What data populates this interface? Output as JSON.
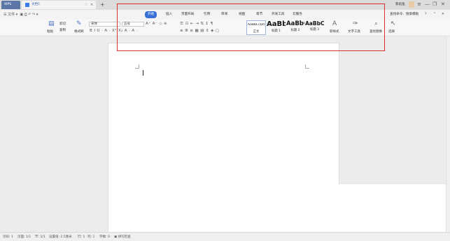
{
  "tabbar": {
    "app_tab": "WPS",
    "doc_tab": "文档1",
    "new_tab": "+",
    "user_name": "紫焰鱼",
    "window_controls": [
      "≡",
      "—",
      "❐",
      "✕"
    ]
  },
  "menubar": {
    "file_menu": "☰ 文件 ▾",
    "tabs": [
      "开始",
      "插入",
      "页面布局",
      "引用",
      "审阅",
      "视图",
      "章节",
      "开发工具",
      "云服务"
    ],
    "active_tab": "开始",
    "search": "查找命令、搜索模板",
    "right_icons": [
      "?",
      "⌃",
      "✕"
    ]
  },
  "ribbon": {
    "paste": "粘贴",
    "cut": "剪切",
    "copy": "复制",
    "format_painter": "格式刷",
    "font_name": "宋体",
    "font_size": "五号",
    "styles": [
      {
        "sample": "AaBbCcDd",
        "name": "正文"
      },
      {
        "sample": "AaBb",
        "name": "标题 1"
      },
      {
        "sample": "AaBbC",
        "name": "标题 2"
      },
      {
        "sample": "AaBbC",
        "name": "标题 3"
      }
    ],
    "new_style": "新样式",
    "text_tools": "文字工具",
    "find_replace": "查找替换",
    "select": "选择"
  },
  "statusbar": {
    "page_num": "页码: 1",
    "pages": "页面: 1/1",
    "section": "节: 1/1",
    "setting": "设置值: 2.5厘米",
    "row": "行: 1",
    "col": "列: 1",
    "word_count": "字数: 0",
    "spell_check": "拼写检查"
  },
  "colors": {
    "accent": "#3a6fd8",
    "highlight_box": "#d93030",
    "wps_tab": "#5b77a8"
  }
}
